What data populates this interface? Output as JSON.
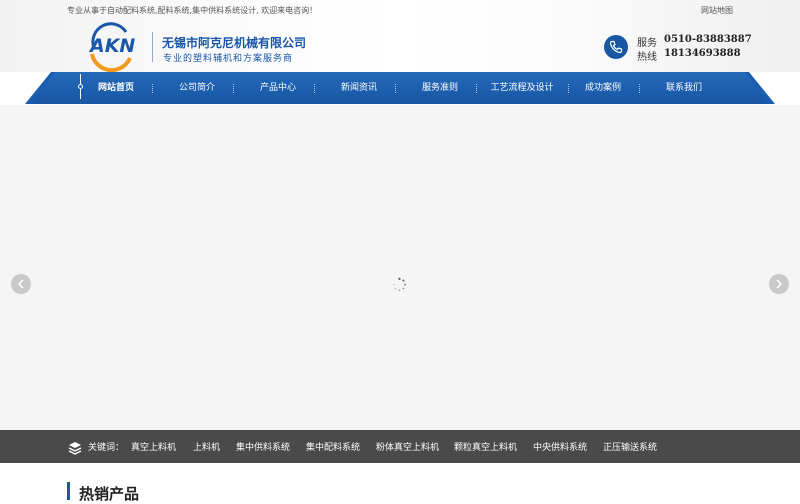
{
  "topbar": {
    "intro": "专业从事于自动配料系统,配料系统,集中供料系统设计, 欢迎来电咨询！",
    "sitemap": "网站地图"
  },
  "brand": {
    "name": "无锡市阿克尼机械有限公司",
    "slogan": "专业的塑料辅机和方案服务商",
    "logo_text": "AKN",
    "colors": {
      "primary": "#1a57a9",
      "accent": "#f29a1f"
    }
  },
  "contact": {
    "service_label": "服务",
    "service_number": "0510-83883887",
    "hotline_label": "热线",
    "hotline_number": "18134693888",
    "icon": "phone-icon"
  },
  "nav": {
    "items": [
      {
        "label": "网站首页",
        "active": true
      },
      {
        "label": "公司简介"
      },
      {
        "label": "产品中心"
      },
      {
        "label": "新闻资讯"
      },
      {
        "label": "服务准则"
      },
      {
        "label": "工艺流程及设计"
      },
      {
        "label": "成功案例"
      },
      {
        "label": "联系我们"
      }
    ]
  },
  "banner": {
    "prev_icon": "chevron-left-icon",
    "next_icon": "chevron-right-icon",
    "loading_icon": "spinner-icon"
  },
  "keywords": {
    "label": "关键词：",
    "icon": "layers-icon",
    "items": [
      "真空上料机",
      "上料机",
      "集中供料系统",
      "集中配料系统",
      "粉体真空上料机",
      "颗粒真空上料机",
      "中央供料系统",
      "正压输送系统"
    ]
  },
  "section": {
    "title": "热销产品"
  }
}
